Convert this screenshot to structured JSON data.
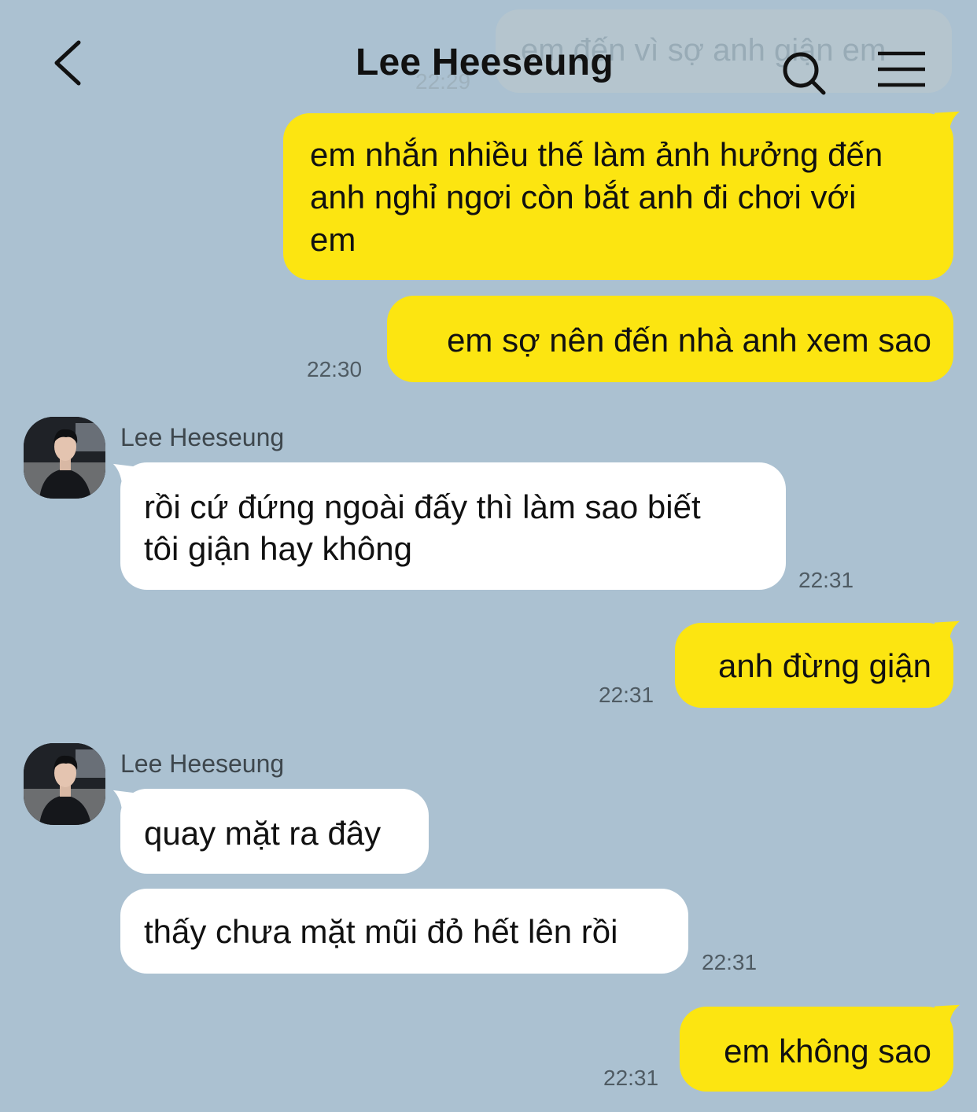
{
  "header": {
    "title": "Lee Heeseung",
    "back_icon": "chevron-left-icon",
    "search_icon": "search-icon",
    "menu_icon": "hamburger-menu-icon"
  },
  "ghost_message": {
    "text": "em đến vì sợ anh giận em",
    "time": "22:29"
  },
  "messages": [
    {
      "from": "me",
      "lines": [
        "em nhắn nhiều thế làm ảnh hưởng đến",
        "anh nghỉ ngơi còn bắt anh đi chơi với",
        "em"
      ],
      "time": ""
    },
    {
      "from": "me",
      "lines": [
        "em sợ nên đến nhà anh xem sao"
      ],
      "time": "22:30"
    },
    {
      "from": "them",
      "sender": "Lee Heeseung",
      "lines": [
        "rồi cứ đứng ngoài đấy thì làm sao biết",
        "tôi giận hay không"
      ],
      "time": "22:31"
    },
    {
      "from": "me",
      "lines": [
        "anh đừng giận"
      ],
      "time": "22:31"
    },
    {
      "from": "them",
      "sender": "Lee Heeseung",
      "lines": [
        "quay mặt ra đây"
      ],
      "time": ""
    },
    {
      "from": "them",
      "lines": [
        "thấy chưa mặt mũi đỏ hết lên rồi"
      ],
      "time": "22:31"
    },
    {
      "from": "me",
      "lines": [
        "em không sao"
      ],
      "time": "22:31"
    }
  ],
  "colors": {
    "background": "#abc1d1",
    "my_bubble": "#fce511",
    "their_bubble": "#ffffff",
    "timestamp": "#4f5b63"
  }
}
